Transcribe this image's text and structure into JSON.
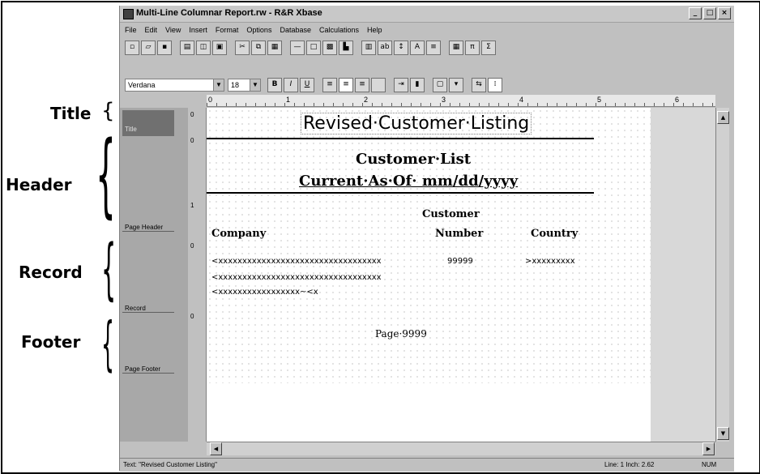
{
  "callouts": {
    "title": "Title",
    "header": "Header",
    "record": "Record",
    "footer": "Footer"
  },
  "window": {
    "title": "Multi-Line Columnar Report.rw - R&R Xbase"
  },
  "menu": [
    "File",
    "Edit",
    "View",
    "Insert",
    "Format",
    "Options",
    "Database",
    "Calculations",
    "Help"
  ],
  "toolbar2": {
    "font": "Verdana",
    "size": "18"
  },
  "bands": {
    "title": "Title",
    "page_header": "Page Header",
    "record": "Record",
    "page_footer": "Page Footer"
  },
  "ruler": [
    "0",
    "1",
    "2",
    "3",
    "4",
    "5",
    "6"
  ],
  "vruler": [
    "0",
    "0",
    "1",
    "0",
    "0"
  ],
  "report": {
    "title": "Revised·Customer·Listing",
    "header_line1": "Customer·List",
    "header_line2": "Current·As·Of· mm/dd/yyyy",
    "col_customer": "Customer",
    "col_company": "Company",
    "col_number": "Number",
    "col_country": "Country",
    "rec1_company": "<xxxxxxxxxxxxxxxxxxxxxxxxxxxxxxxxxx",
    "rec1_number": "99999",
    "rec1_country": ">xxxxxxxxx",
    "rec2": "<xxxxxxxxxxxxxxxxxxxxxxxxxxxxxxxxxx",
    "rec3": "<xxxxxxxxxxxxxxxxx~<x",
    "footer": "Page·9999"
  },
  "status": {
    "text": "Text: \"Revised Customer Listing\"",
    "line": "Line: 1 Inch: 2.62",
    "num": "NUM"
  }
}
